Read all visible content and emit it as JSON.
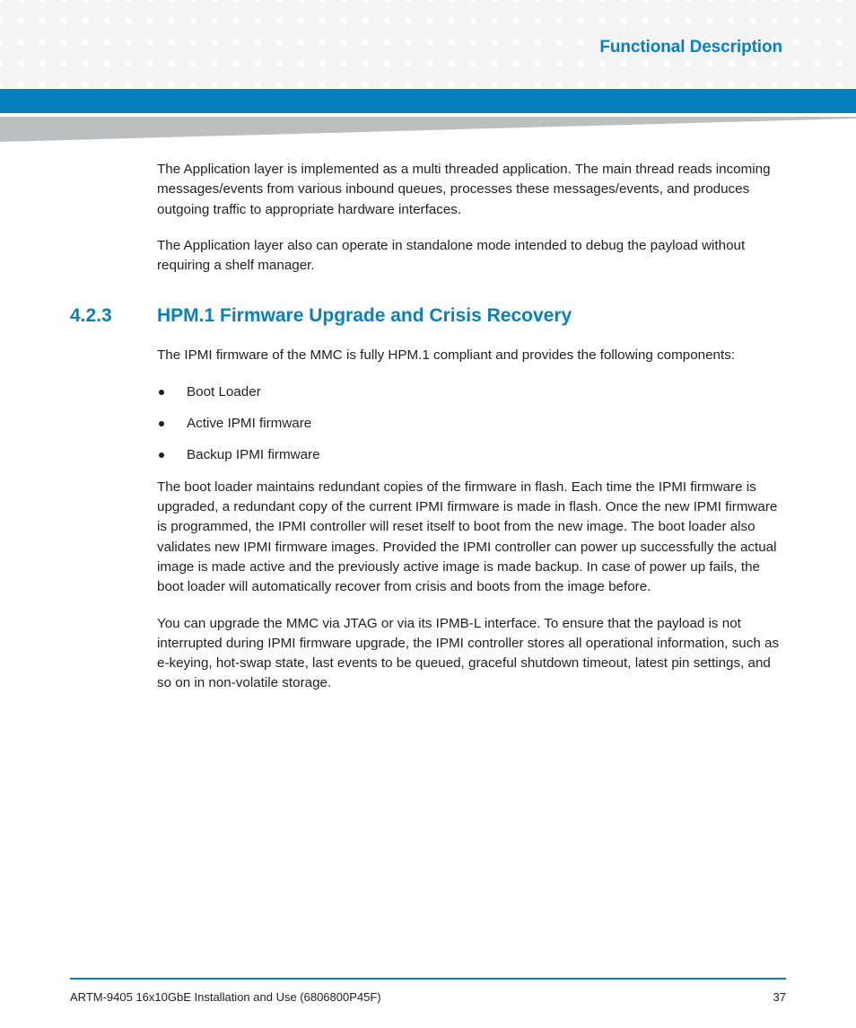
{
  "header": {
    "title": "Functional Description",
    "accent_blue": "#0780be",
    "square_gray": "#f4f4f4",
    "wedge_gray": "#bcbec0"
  },
  "section": {
    "number": "4.2.3",
    "title": "HPM.1 Firmware Upgrade and Crisis Recovery",
    "heading_color": "#0b7fbd"
  },
  "body": {
    "para1": "The Application layer is implemented as a multi threaded application. The main thread reads incoming messages/events from various inbound queues, processes these messages/events, and produces outgoing traffic to appropriate hardware interfaces.",
    "para2": "The Application layer also can operate in standalone mode intended to debug the payload without requiring a shelf manager.",
    "para3": "The IPMI firmware of the MMC is fully HPM.1 compliant and provides the following components:",
    "para4": "The boot loader maintains redundant copies of the firmware in flash. Each time the IPMI firmware is upgraded, a redundant copy of the current IPMI firmware is made in flash. Once the new IPMI firmware is programmed, the IPMI controller will reset itself to boot from the new image. The boot loader also validates new IPMI firmware images. Provided the IPMI controller can power up successfully the actual image is made active and the previously active image is made backup. In case of power up fails, the boot loader will automatically recover from crisis and boots from the image before.",
    "para5": "You can upgrade the MMC via JTAG or via its IPMB-L interface. To ensure that the payload is not interrupted during IPMI firmware upgrade, the IPMI controller stores all operational information, such as e-keying, hot-swap state, last events to be queued, graceful shutdown timeout, latest pin settings, and so on in non-volatile storage.",
    "bullets": [
      "Boot Loader",
      "Active IPMI firmware",
      "Backup IPMI firmware"
    ]
  },
  "footer": {
    "document": "ARTM-9405 16x10GbE Installation and Use (6806800P45F)",
    "page_number": "37",
    "rule_color": "#0780be"
  }
}
